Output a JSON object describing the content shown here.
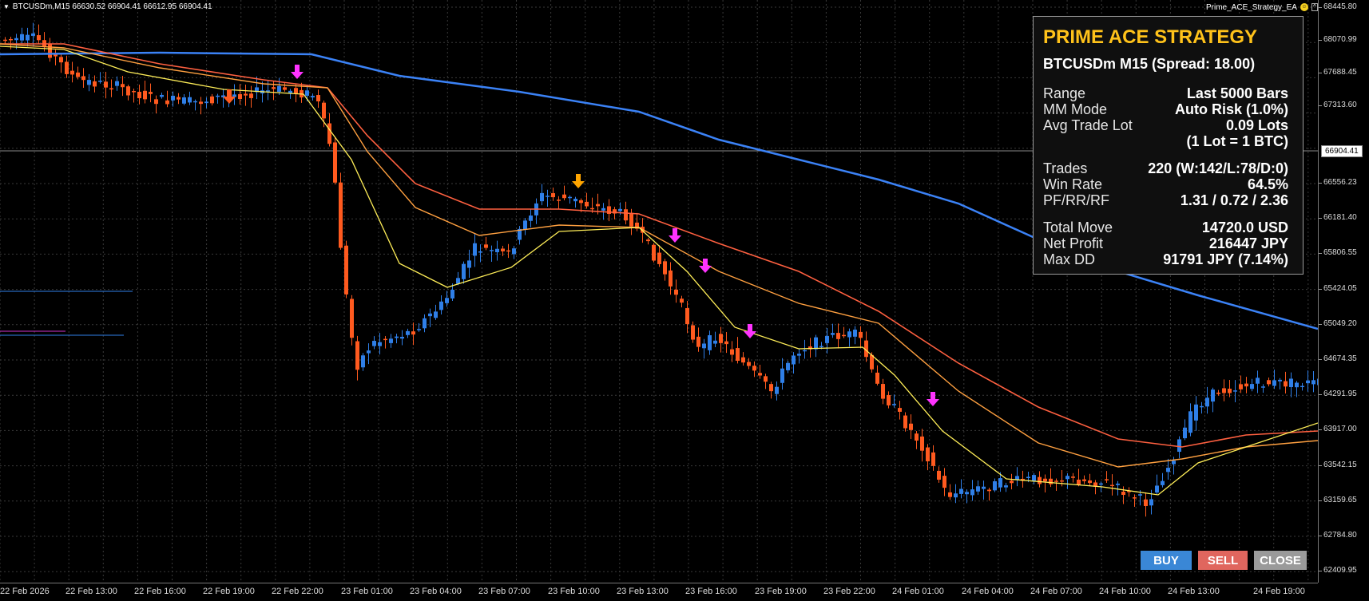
{
  "chart": {
    "symbol_header": "BTCUSDm,M15  66630.52 66904.41 66612.95 66904.41",
    "ea_name": "Prime_ACE_Strategy_EA",
    "current_price": "66904.41",
    "y_ticks": [
      "68445.80",
      "68070.99",
      "67688.45",
      "67313.60",
      "66904.41",
      "66556.23",
      "66181.40",
      "65806.55",
      "65424.05",
      "65049.20",
      "64674.35",
      "64291.95",
      "63917.00",
      "63542.15",
      "63159.65",
      "62784.80",
      "62409.95"
    ],
    "x_ticks": [
      "22 Feb 2026",
      "22 Feb 13:00",
      "22 Feb 16:00",
      "22 Feb 19:00",
      "22 Feb 22:00",
      "23 Feb 01:00",
      "23 Feb 04:00",
      "23 Feb 07:00",
      "23 Feb 10:00",
      "23 Feb 13:00",
      "23 Feb 16:00",
      "23 Feb 19:00",
      "23 Feb 22:00",
      "24 Feb 01:00",
      "24 Feb 04:00",
      "24 Feb 07:00",
      "24 Feb 10:00",
      "24 Feb 13:00",
      "24 Feb 19:00"
    ]
  },
  "panel": {
    "title": "PRIME ACE STRATEGY",
    "subtitle": "BTCUSDm M15 (Spread: 18.00)",
    "range_label": "Range",
    "range_value": "Last 5000 Bars",
    "mm_label": "MM Mode",
    "mm_value": "Auto Risk (1.0%)",
    "lot_label": "Avg Trade Lot",
    "lot_value": "0.09 Lots",
    "lot_note": "(1 Lot = 1 BTC)",
    "trades_label": "Trades",
    "trades_value": "220 (W:142/L:78/D:0)",
    "winrate_label": "Win Rate",
    "winrate_value": "64.5%",
    "pf_label": "PF/RR/RF",
    "pf_value": "1.31 / 0.72 / 2.36",
    "move_label": "Total Move",
    "move_value": "14720.0 USD",
    "profit_label": "Net Profit",
    "profit_value": "216447 JPY",
    "dd_label": "Max DD",
    "dd_value": "91791 JPY (7.14%)"
  },
  "buttons": {
    "buy": "BUY",
    "sell": "SELL",
    "close": "CLOSE"
  },
  "colors": {
    "bull": "#2f7fe8",
    "bear": "#ff5a1f",
    "title": "#ffc21a",
    "ma_fast": "#ffee58",
    "ma_mid": "#ffa040",
    "ma_slow": "#ff6040",
    "ma_long": "#3b82f6",
    "sell_arrow": "#ff33ff",
    "alt_arrow": "#ffa500"
  },
  "icons": {
    "header_arrow": "triangle-down-icon",
    "ea_face": "smiley-face-icon",
    "ea_menu": "caret-icon",
    "signal": "down-arrow-icon"
  }
}
